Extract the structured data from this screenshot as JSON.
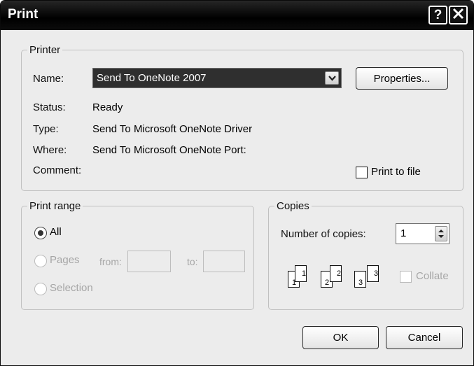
{
  "title": "Print",
  "title_buttons": {
    "help": "?",
    "close": "X"
  },
  "printer_group": {
    "legend": "Printer",
    "name_label": "Name:",
    "selected_printer": "Send To OneNote 2007",
    "properties_button": "Properties...",
    "status_label": "Status:",
    "status_value": "Ready",
    "type_label": "Type:",
    "type_value": "Send To Microsoft OneNote Driver",
    "where_label": "Where:",
    "where_value": "Send To Microsoft OneNote Port:",
    "comment_label": "Comment:",
    "print_to_file_label": "Print to file",
    "print_to_file_checked": false
  },
  "print_range": {
    "legend": "Print range",
    "all_label": "All",
    "pages_label": "Pages",
    "from_label": "from:",
    "to_label": "to:",
    "selection_label": "Selection",
    "selected": "All"
  },
  "copies": {
    "legend": "Copies",
    "number_label": "Number of copies:",
    "number_value": "1",
    "collate_label": "Collate",
    "collate_checked": false,
    "collate_icon_pages": [
      "1",
      "1",
      "2",
      "2",
      "3",
      "3"
    ]
  },
  "footer": {
    "ok_button": "OK",
    "cancel_button": "Cancel"
  },
  "colors": {
    "titlebar": "#000000",
    "dialog_bg": "#ececec",
    "select_bg": "#2f2f2f"
  }
}
